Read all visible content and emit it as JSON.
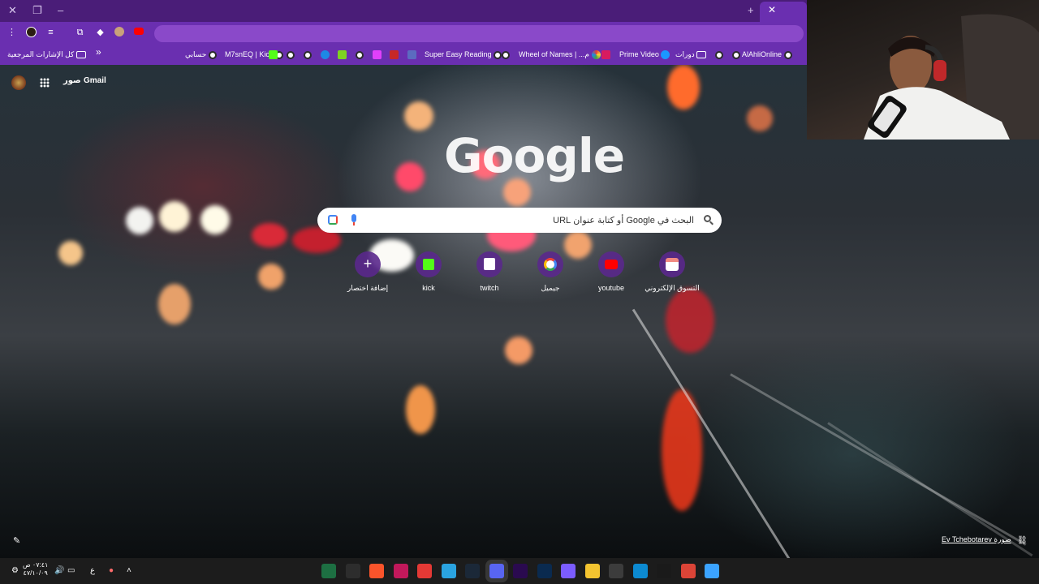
{
  "browser": {
    "bookmarks": [
      {
        "label": "AlAhliOnline",
        "icon": "globe-icon"
      },
      {
        "label": "",
        "icon": "globe-icon"
      },
      {
        "label": "دورات",
        "icon": "folder-icon"
      },
      {
        "label": "",
        "icon": "prime-video-icon"
      },
      {
        "label": "Prime Video",
        "icon": "image-icon"
      },
      {
        "label": "...م",
        "icon": "wheel-icon"
      },
      {
        "label": "Wheel of Names |",
        "icon": "globe-icon"
      },
      {
        "label": "Super Easy Reading",
        "icon": "globe-icon"
      },
      {
        "label": "",
        "icon": "translate-icon"
      },
      {
        "label": "",
        "icon": "pdf-icon"
      },
      {
        "label": "",
        "icon": "image-icon"
      },
      {
        "label": "",
        "icon": "globe-icon"
      },
      {
        "label": "",
        "icon": "download-icon"
      },
      {
        "label": "",
        "icon": "circle-icon"
      },
      {
        "label": "",
        "icon": "globe-icon"
      },
      {
        "label": "",
        "icon": "kick-icon"
      },
      {
        "label": "M7snEQ | Kick",
        "icon": "globe-icon"
      },
      {
        "label": "حسابي",
        "icon": "globe-icon"
      }
    ],
    "all_bookmarks_label": "كل الإشارات المرجعية",
    "more_bookmarks": "»"
  },
  "ntp": {
    "gmail_link": "Gmail",
    "images_link": "صور",
    "logo_text": "Google",
    "search_placeholder": "البحث في Google أو كتابة عنوان URL",
    "shortcuts": [
      {
        "label": "إضافة اختصار",
        "icon": "plus-icon",
        "color": "#ffffff"
      },
      {
        "label": "kick",
        "icon": "kick-icon",
        "color": "#53fc18"
      },
      {
        "label": "twitch",
        "icon": "twitch-icon",
        "color": "#9146ff"
      },
      {
        "label": "جيميل",
        "icon": "google-icon",
        "color": "#4285f4"
      },
      {
        "label": "youtube",
        "icon": "youtube-icon",
        "color": "#ff0000"
      },
      {
        "label": "التسوق الإلكتروني",
        "icon": "shop-icon",
        "color": "#f28b82"
      }
    ],
    "photo_credit": "Ev Tchebotarev صورة"
  },
  "taskbar": {
    "apps": [
      {
        "name": "excel-icon",
        "color": "#1d6f42"
      },
      {
        "name": "terminal-icon",
        "color": "#2d2d2d"
      },
      {
        "name": "brave-icon",
        "color": "#fb542b"
      },
      {
        "name": "affinity-icon",
        "color": "#c2185b"
      },
      {
        "name": "app-red-icon",
        "color": "#e53935"
      },
      {
        "name": "telegram-icon",
        "color": "#2aa3e0"
      },
      {
        "name": "steam-icon",
        "color": "#1b2838"
      },
      {
        "name": "discord-icon",
        "color": "#5865f2"
      },
      {
        "name": "premiere-icon",
        "color": "#2a0a4f"
      },
      {
        "name": "photoshop-icon",
        "color": "#0a2a4f"
      },
      {
        "name": "media-player-icon",
        "color": "#7b5cff"
      },
      {
        "name": "file-explorer-icon",
        "color": "#f4c430"
      },
      {
        "name": "store-icon",
        "color": "#3c3c3c"
      },
      {
        "name": "edge-icon",
        "color": "#0c8ad1"
      },
      {
        "name": "chatgpt-icon",
        "color": "#1a1a1a"
      },
      {
        "name": "chrome-icon",
        "color": "#db4437"
      },
      {
        "name": "windows-start-icon",
        "color": "#3ba3ff"
      }
    ],
    "clock_time": "٠٧:٤١ ص",
    "clock_date": "٤٧/١٠/٠٩",
    "language": "ع"
  }
}
